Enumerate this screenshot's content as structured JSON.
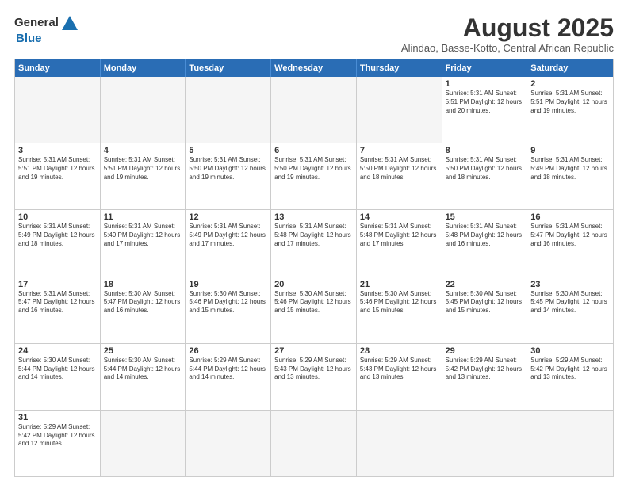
{
  "header": {
    "logo_line1": "General",
    "logo_line2": "Blue",
    "cal_title": "August 2025",
    "cal_subtitle": "Alindao, Basse-Kotto, Central African Republic"
  },
  "days_of_week": [
    "Sunday",
    "Monday",
    "Tuesday",
    "Wednesday",
    "Thursday",
    "Friday",
    "Saturday"
  ],
  "weeks": [
    [
      {
        "day": "",
        "info": ""
      },
      {
        "day": "",
        "info": ""
      },
      {
        "day": "",
        "info": ""
      },
      {
        "day": "",
        "info": ""
      },
      {
        "day": "",
        "info": ""
      },
      {
        "day": "1",
        "info": "Sunrise: 5:31 AM\nSunset: 5:51 PM\nDaylight: 12 hours\nand 20 minutes."
      },
      {
        "day": "2",
        "info": "Sunrise: 5:31 AM\nSunset: 5:51 PM\nDaylight: 12 hours\nand 19 minutes."
      }
    ],
    [
      {
        "day": "3",
        "info": "Sunrise: 5:31 AM\nSunset: 5:51 PM\nDaylight: 12 hours\nand 19 minutes."
      },
      {
        "day": "4",
        "info": "Sunrise: 5:31 AM\nSunset: 5:51 PM\nDaylight: 12 hours\nand 19 minutes."
      },
      {
        "day": "5",
        "info": "Sunrise: 5:31 AM\nSunset: 5:50 PM\nDaylight: 12 hours\nand 19 minutes."
      },
      {
        "day": "6",
        "info": "Sunrise: 5:31 AM\nSunset: 5:50 PM\nDaylight: 12 hours\nand 19 minutes."
      },
      {
        "day": "7",
        "info": "Sunrise: 5:31 AM\nSunset: 5:50 PM\nDaylight: 12 hours\nand 18 minutes."
      },
      {
        "day": "8",
        "info": "Sunrise: 5:31 AM\nSunset: 5:50 PM\nDaylight: 12 hours\nand 18 minutes."
      },
      {
        "day": "9",
        "info": "Sunrise: 5:31 AM\nSunset: 5:49 PM\nDaylight: 12 hours\nand 18 minutes."
      }
    ],
    [
      {
        "day": "10",
        "info": "Sunrise: 5:31 AM\nSunset: 5:49 PM\nDaylight: 12 hours\nand 18 minutes."
      },
      {
        "day": "11",
        "info": "Sunrise: 5:31 AM\nSunset: 5:49 PM\nDaylight: 12 hours\nand 17 minutes."
      },
      {
        "day": "12",
        "info": "Sunrise: 5:31 AM\nSunset: 5:49 PM\nDaylight: 12 hours\nand 17 minutes."
      },
      {
        "day": "13",
        "info": "Sunrise: 5:31 AM\nSunset: 5:48 PM\nDaylight: 12 hours\nand 17 minutes."
      },
      {
        "day": "14",
        "info": "Sunrise: 5:31 AM\nSunset: 5:48 PM\nDaylight: 12 hours\nand 17 minutes."
      },
      {
        "day": "15",
        "info": "Sunrise: 5:31 AM\nSunset: 5:48 PM\nDaylight: 12 hours\nand 16 minutes."
      },
      {
        "day": "16",
        "info": "Sunrise: 5:31 AM\nSunset: 5:47 PM\nDaylight: 12 hours\nand 16 minutes."
      }
    ],
    [
      {
        "day": "17",
        "info": "Sunrise: 5:31 AM\nSunset: 5:47 PM\nDaylight: 12 hours\nand 16 minutes."
      },
      {
        "day": "18",
        "info": "Sunrise: 5:30 AM\nSunset: 5:47 PM\nDaylight: 12 hours\nand 16 minutes."
      },
      {
        "day": "19",
        "info": "Sunrise: 5:30 AM\nSunset: 5:46 PM\nDaylight: 12 hours\nand 15 minutes."
      },
      {
        "day": "20",
        "info": "Sunrise: 5:30 AM\nSunset: 5:46 PM\nDaylight: 12 hours\nand 15 minutes."
      },
      {
        "day": "21",
        "info": "Sunrise: 5:30 AM\nSunset: 5:46 PM\nDaylight: 12 hours\nand 15 minutes."
      },
      {
        "day": "22",
        "info": "Sunrise: 5:30 AM\nSunset: 5:45 PM\nDaylight: 12 hours\nand 15 minutes."
      },
      {
        "day": "23",
        "info": "Sunrise: 5:30 AM\nSunset: 5:45 PM\nDaylight: 12 hours\nand 14 minutes."
      }
    ],
    [
      {
        "day": "24",
        "info": "Sunrise: 5:30 AM\nSunset: 5:44 PM\nDaylight: 12 hours\nand 14 minutes."
      },
      {
        "day": "25",
        "info": "Sunrise: 5:30 AM\nSunset: 5:44 PM\nDaylight: 12 hours\nand 14 minutes."
      },
      {
        "day": "26",
        "info": "Sunrise: 5:29 AM\nSunset: 5:44 PM\nDaylight: 12 hours\nand 14 minutes."
      },
      {
        "day": "27",
        "info": "Sunrise: 5:29 AM\nSunset: 5:43 PM\nDaylight: 12 hours\nand 13 minutes."
      },
      {
        "day": "28",
        "info": "Sunrise: 5:29 AM\nSunset: 5:43 PM\nDaylight: 12 hours\nand 13 minutes."
      },
      {
        "day": "29",
        "info": "Sunrise: 5:29 AM\nSunset: 5:42 PM\nDaylight: 12 hours\nand 13 minutes."
      },
      {
        "day": "30",
        "info": "Sunrise: 5:29 AM\nSunset: 5:42 PM\nDaylight: 12 hours\nand 13 minutes."
      }
    ],
    [
      {
        "day": "31",
        "info": "Sunrise: 5:29 AM\nSunset: 5:42 PM\nDaylight: 12 hours\nand 12 minutes."
      },
      {
        "day": "",
        "info": ""
      },
      {
        "day": "",
        "info": ""
      },
      {
        "day": "",
        "info": ""
      },
      {
        "day": "",
        "info": ""
      },
      {
        "day": "",
        "info": ""
      },
      {
        "day": "",
        "info": ""
      }
    ]
  ]
}
